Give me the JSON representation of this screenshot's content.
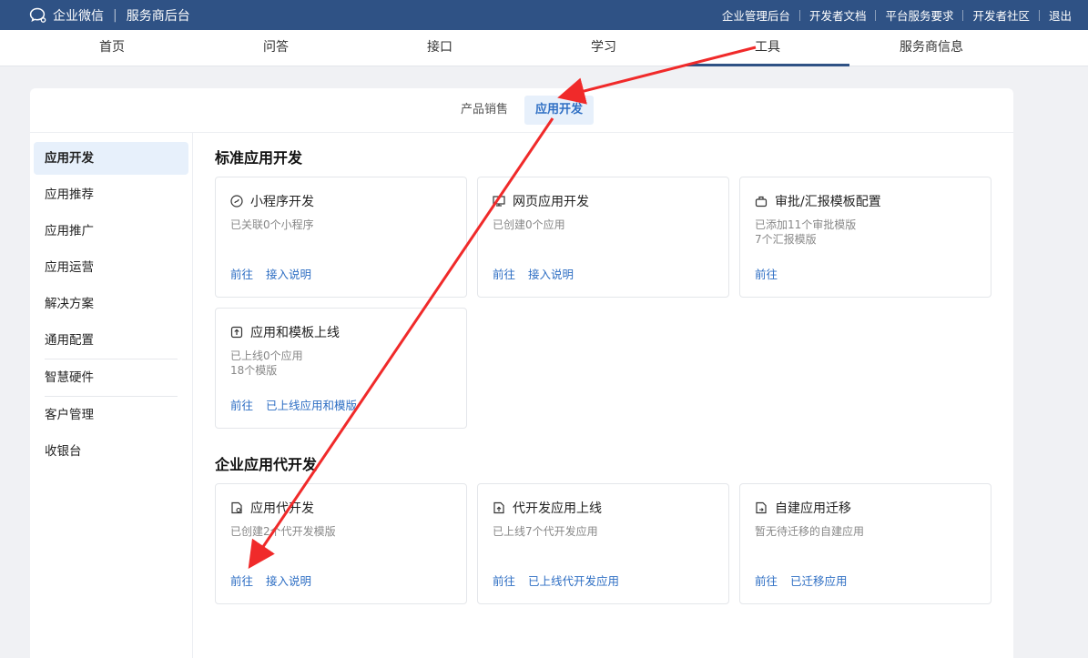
{
  "topbar": {
    "brand": "企业微信",
    "subtitle": "服务商后台",
    "links": [
      "企业管理后台",
      "开发者文档",
      "平台服务要求",
      "开发者社区",
      "退出"
    ]
  },
  "nav": {
    "tabs": [
      "首页",
      "问答",
      "接口",
      "学习",
      "工具",
      "服务商信息"
    ],
    "active": "工具"
  },
  "subtabs": {
    "items": [
      "产品销售",
      "应用开发"
    ],
    "active": "应用开发"
  },
  "sidebar": {
    "items": [
      "应用开发",
      "应用推荐",
      "应用推广",
      "应用运营",
      "解决方案",
      "通用配置",
      "智慧硬件",
      "客户管理",
      "收银台"
    ],
    "active": "应用开发"
  },
  "sections": [
    {
      "title": "标准应用开发",
      "cards": [
        {
          "icon": "mini-program-icon",
          "title": "小程序开发",
          "desc": [
            "已关联0个小程序"
          ],
          "links": [
            "前往",
            "接入说明"
          ]
        },
        {
          "icon": "web-app-icon",
          "title": "网页应用开发",
          "desc": [
            "已创建0个应用"
          ],
          "links": [
            "前往",
            "接入说明"
          ]
        },
        {
          "icon": "approval-template-icon",
          "title": "审批/汇报模板配置",
          "desc": [
            "已添加11个审批模版",
            "7个汇报模版"
          ],
          "links": [
            "前往"
          ]
        },
        {
          "icon": "upload-icon",
          "title": "应用和模板上线",
          "desc": [
            "已上线0个应用",
            "18个模版"
          ],
          "links": [
            "前往",
            "已上线应用和模版"
          ]
        }
      ]
    },
    {
      "title": "企业应用代开发",
      "cards": [
        {
          "icon": "delegate-dev-icon",
          "title": "应用代开发",
          "desc": [
            "已创建2个代开发模版"
          ],
          "links": [
            "前往",
            "接入说明"
          ]
        },
        {
          "icon": "delegate-launch-icon",
          "title": "代开发应用上线",
          "desc": [
            "已上线7个代开发应用"
          ],
          "links": [
            "前往",
            "已上线代开发应用"
          ]
        },
        {
          "icon": "migrate-icon",
          "title": "自建应用迁移",
          "desc": [
            "暂无待迁移的自建应用"
          ],
          "links": [
            "前往",
            "已迁移应用"
          ]
        }
      ]
    }
  ],
  "colors": {
    "topbar": "#2f5285",
    "accent": "#2f6fc4",
    "arrow": "#f02a2a"
  }
}
